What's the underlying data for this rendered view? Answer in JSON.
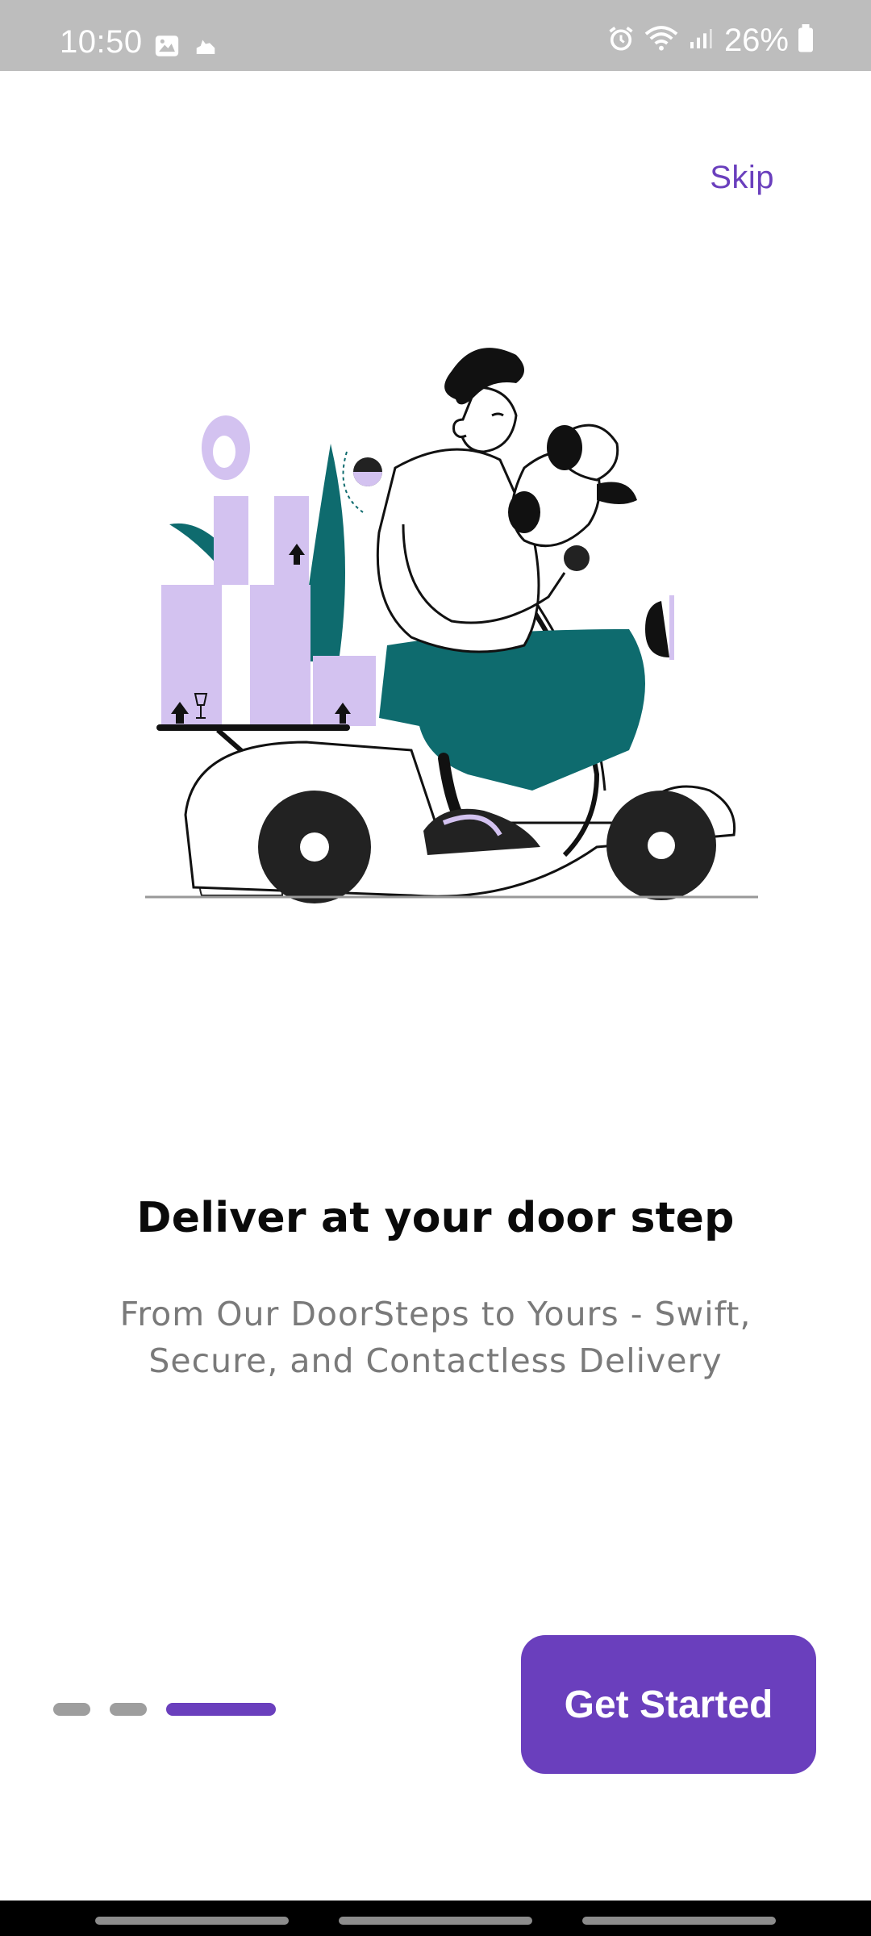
{
  "status_bar": {
    "time": "10:50",
    "battery_percent": "26%",
    "left_icons": [
      "image-icon",
      "notification-icon"
    ],
    "right_icons": [
      "alarm-icon",
      "wifi-icon",
      "signal-icon",
      "battery-icon"
    ]
  },
  "header": {
    "skip_label": "Skip"
  },
  "onboarding": {
    "title": "Deliver at your door step",
    "subtitle_line1": "From Our DoorSteps to Yours - Swift,",
    "subtitle_line2": "Secure, and Contactless Delivery",
    "page_index": 3,
    "page_count": 3
  },
  "actions": {
    "get_started_label": "Get Started"
  },
  "colors": {
    "accent": "#6a3fbd",
    "status_bar_bg": "#bdbdbd",
    "inactive_dot": "#9e9e9e",
    "box_lilac": "#d3c2f0",
    "teal": "#0e6b6e",
    "subtitle_gray": "#7a7a7a"
  }
}
